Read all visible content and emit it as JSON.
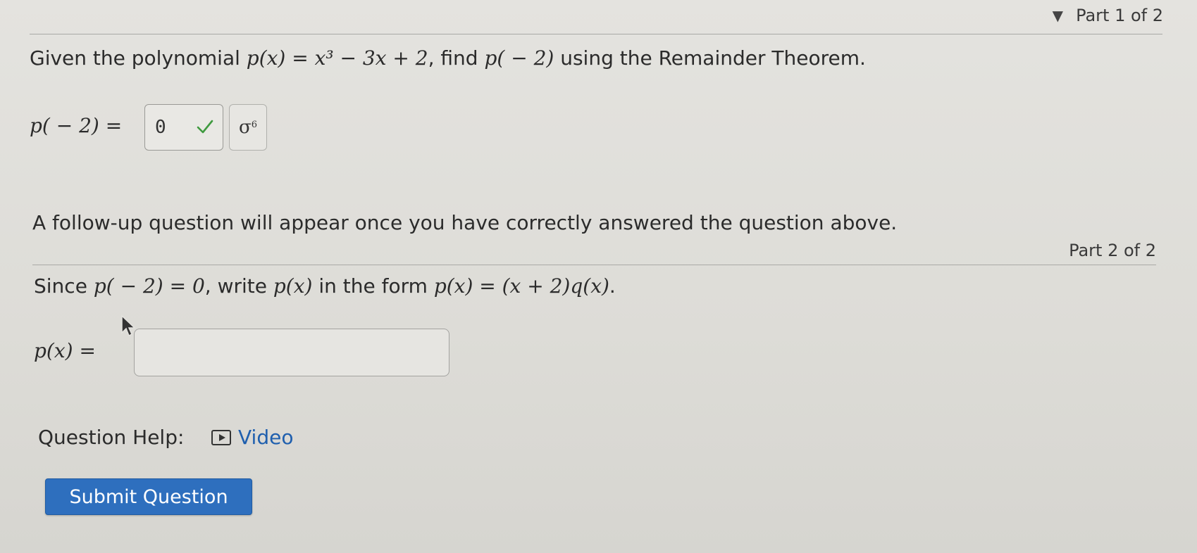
{
  "part1": {
    "header": "Part 1 of 2",
    "question_prefix": "Given the polynomial ",
    "question_expr": "p(x) = x³ − 3x + 2",
    "question_mid": ", find ",
    "question_target": "p( − 2)",
    "question_suffix": " using the Remainder Theorem.",
    "answer_label": "p( − 2)",
    "equals": "=",
    "answer_value": "0",
    "answer_status_icon": "check-icon",
    "math_button_label": "σ",
    "math_button_sup": "6"
  },
  "followup_notice": "A follow-up question will appear once you have correctly answered the question above.",
  "part2": {
    "header": "Part 2 of 2",
    "question_prefix": "Since ",
    "question_cond": "p( − 2) = 0",
    "question_mid": ", write ",
    "question_fn": "p(x)",
    "question_form_text": " in the form ",
    "question_form": "p(x) = (x + 2)q(x)",
    "question_end": ".",
    "answer_label": "p(x) =",
    "answer_value": ""
  },
  "help": {
    "label": "Question Help:",
    "video_label": "Video"
  },
  "submit_label": "Submit Question",
  "colors": {
    "accent": "#2e6fbe",
    "link": "#1f5fae",
    "check": "#3f9a3f"
  }
}
